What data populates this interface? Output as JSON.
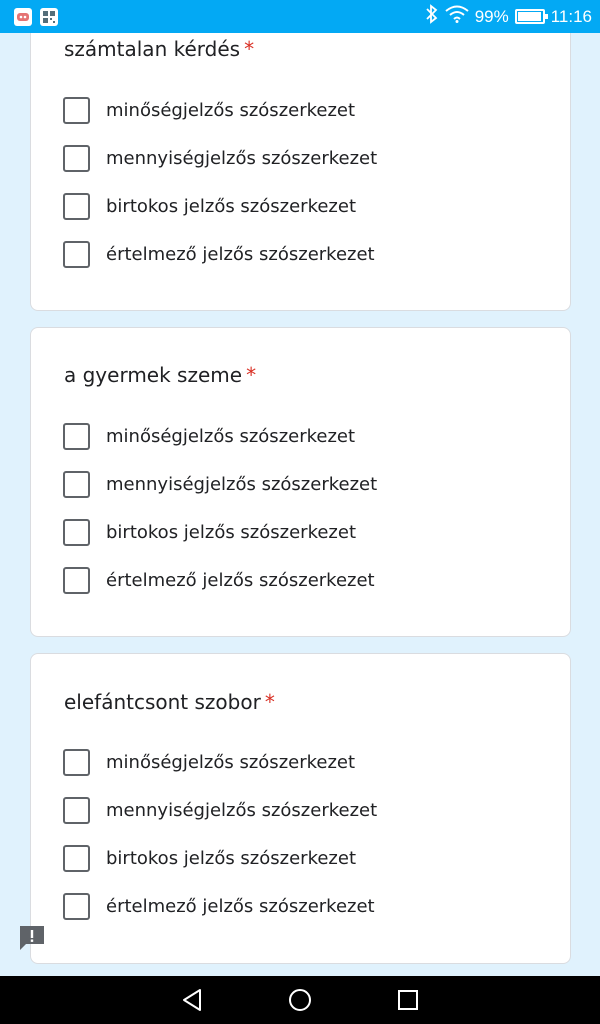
{
  "status_bar": {
    "battery_percent": "99%",
    "battery_level": 0.99,
    "time": "11:16",
    "icons": [
      "notification-app-icon",
      "qr-app-icon",
      "bluetooth-icon",
      "wifi-icon",
      "battery-icon"
    ]
  },
  "questions": [
    {
      "title": "számtalan kérdés",
      "required_mark": "*",
      "options": [
        "minőségjelzős szószerkezet",
        "mennyiségjelzős szószerkezet",
        "birtokos jelzős szószerkezet",
        "értelmező jelzős szószerkezet"
      ]
    },
    {
      "title": "a gyermek szeme",
      "required_mark": "*",
      "options": [
        "minőségjelzős szószerkezet",
        "mennyiségjelzős szószerkezet",
        "birtokos jelzős szószerkezet",
        "értelmező jelzős szószerkezet"
      ]
    },
    {
      "title": "elefántcsont szobor",
      "required_mark": "*",
      "options": [
        "minőségjelzős szószerkezet",
        "mennyiségjelzős szószerkezet",
        "birtokos jelzős szószerkezet",
        "értelmező jelzős szószerkezet"
      ]
    }
  ],
  "colors": {
    "status_bar": "#03a9f4",
    "page_background": "#e0f2fd",
    "required_star": "#d93025",
    "checkbox_border": "#5f6368"
  },
  "nav_bar": {
    "icons": [
      "back-icon",
      "home-icon",
      "recents-icon"
    ]
  }
}
